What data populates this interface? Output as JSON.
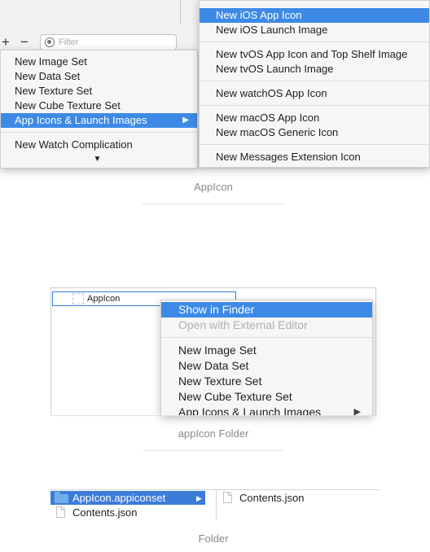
{
  "section1": {
    "filter_placeholder": "Filter",
    "plus_label": "+",
    "minus_label": "−",
    "left_menu": {
      "items": [
        "New Image Set",
        "New Data Set",
        "New Texture Set",
        "New Cube Texture Set"
      ],
      "highlighted": "App Icons & Launch Images",
      "highlighted_arrow": "▶",
      "after_separator": "New Watch Complication",
      "scroll_arrow": "▼"
    },
    "right_menu": {
      "ios_app_icon": "New iOS App Icon",
      "ios_launch_image": "New iOS Launch Image",
      "tvos_app_icon": "New tvOS App Icon and Top Shelf Image",
      "tvos_launch_image": "New tvOS Launch Image",
      "watchos_app_icon": "New watchOS App Icon",
      "macos_app_icon": "New macOS App Icon",
      "macos_generic_icon": "New macOS Generic Icon",
      "messages_icon": "New Messages Extension Icon"
    },
    "caption": "AppIcon"
  },
  "section2": {
    "item_label": "AppIcon",
    "context_menu": {
      "show_in_finder": "Show in Finder",
      "open_external": "Open with External Editor",
      "new_image_set": "New Image Set",
      "new_data_set": "New Data Set",
      "new_texture_set": "New Texture Set",
      "new_cube_texture_set": "New Cube Texture Set",
      "app_icons_launch": "App Icons & Launch Images",
      "submenu_arrow": "▶"
    },
    "caption": "appIcon Folder"
  },
  "section3": {
    "folder_name": "AppIcon.appiconset",
    "folder_arrow": "▶",
    "col1_file": "Contents.json",
    "col2_file": "Contents.json",
    "caption": "Folder"
  },
  "colors": {
    "selection_blue": "#3d8ae6",
    "finder_blue": "#3d7bd9",
    "folder_icon": "#6fb0ea"
  }
}
